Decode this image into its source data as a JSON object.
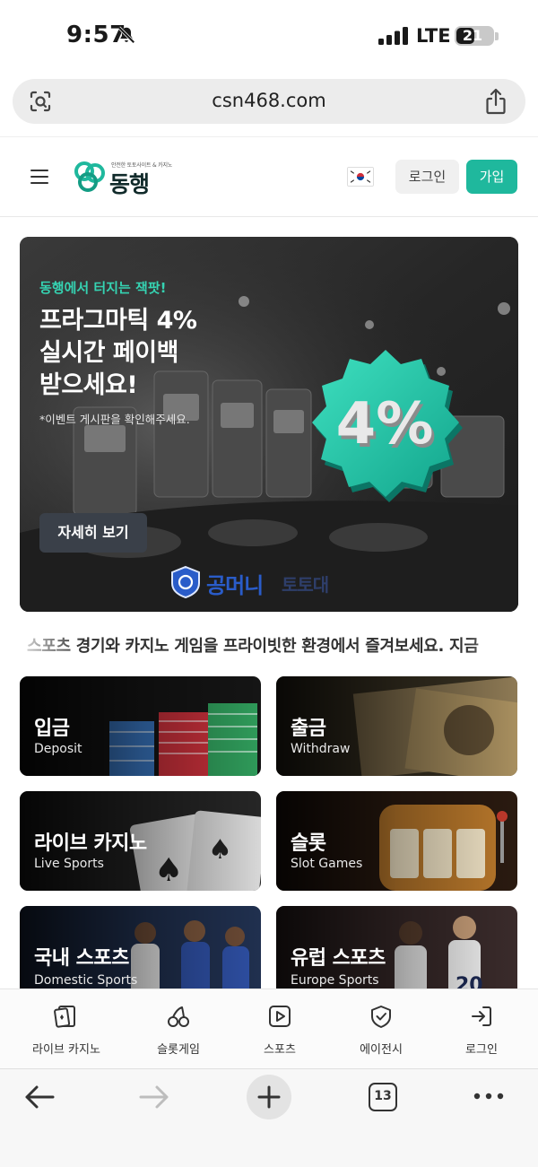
{
  "status_bar": {
    "time": "9:57",
    "network": "LTE",
    "battery_level": "21"
  },
  "url_bar": {
    "url": "csn468.com"
  },
  "header": {
    "logo_tagline": "안전한 토토사이트 & 카지노",
    "logo_name": "동행",
    "login_label": "로그인",
    "join_label": "가입",
    "accent_color": "#1fb89d"
  },
  "hero": {
    "kicker": "동행에서 터지는 잭팟!",
    "title": "프라그마틱 4%\n실시간 페이백\n받으세요!",
    "note": "*이벤트 게시판을 확인해주세요.",
    "button_label": "자세히 보기",
    "badge_text": "4%",
    "watermark": "공머니",
    "watermark_suffix": "토토대"
  },
  "marquee": {
    "text": "스포츠 경기와 카지노 게임을 프라이빗한 환경에서 즐겨보세요. 지금"
  },
  "tiles": [
    {
      "title": "입금",
      "subtitle": "Deposit"
    },
    {
      "title": "출금",
      "subtitle": "Withdraw"
    },
    {
      "title": "라이브 카지노",
      "subtitle": "Live Sports"
    },
    {
      "title": "슬롯",
      "subtitle": "Slot Games"
    },
    {
      "title": "국내 스포츠",
      "subtitle": "Domestic Sports"
    },
    {
      "title": "유럽 스포츠",
      "subtitle": "Europe Sports"
    }
  ],
  "bottom_nav": [
    {
      "label": "라이브 카지노",
      "icon": "cards-icon"
    },
    {
      "label": "슬롯게임",
      "icon": "cherry-icon"
    },
    {
      "label": "스포츠",
      "icon": "play-icon"
    },
    {
      "label": "에이전시",
      "icon": "shield-check-icon"
    },
    {
      "label": "로그인",
      "icon": "login-icon"
    }
  ],
  "browser_toolbar": {
    "tab_count": "13"
  }
}
